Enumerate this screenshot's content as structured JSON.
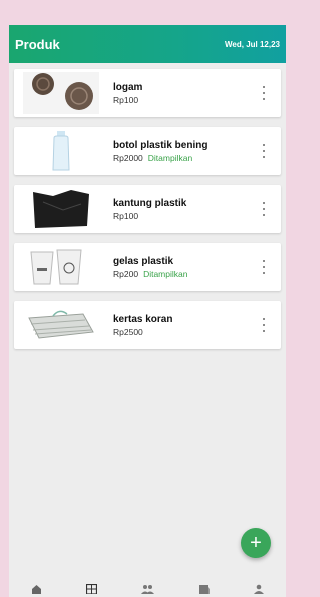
{
  "appbar": {
    "title": "Produk",
    "date": "Wed, Jul 12,23"
  },
  "products": [
    {
      "name": "logam",
      "price": "Rp100",
      "status": ""
    },
    {
      "name": "botol plastik bening",
      "price": "Rp2000",
      "status": "Ditampilkan"
    },
    {
      "name": "kantung plastik",
      "price": "Rp100",
      "status": ""
    },
    {
      "name": "gelas plastik",
      "price": "Rp200",
      "status": "Ditampilkan"
    },
    {
      "name": "kertas koran",
      "price": "Rp2500",
      "status": ""
    }
  ],
  "fab": {
    "label": "+"
  },
  "colors": {
    "accent": "#1aa66f",
    "status": "#3aa34a",
    "fab": "#3aa65a"
  },
  "nav": {
    "icons": [
      "home-icon",
      "catalog-icon",
      "people-icon",
      "store-icon",
      "profile-icon"
    ]
  }
}
